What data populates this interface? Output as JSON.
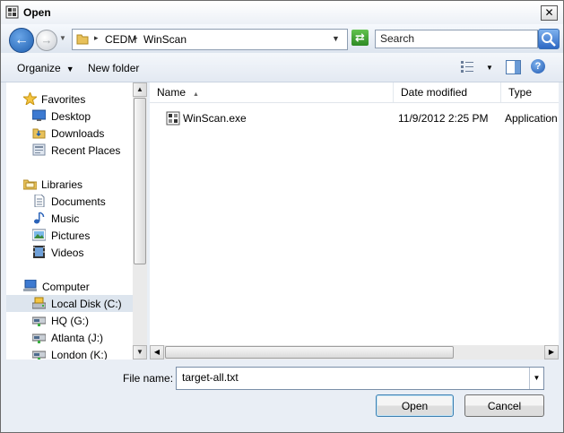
{
  "title": "Open",
  "close_label": "✕",
  "nav": {
    "back_glyph": "←",
    "forward_glyph": "→",
    "breadcrumb": [
      "CEDM",
      "WinScan"
    ],
    "separator": "▸",
    "search_placeholder": "Search"
  },
  "toolbar": {
    "organize_label": "Organize",
    "new_folder_label": "New folder",
    "help_glyph": "?"
  },
  "sidebar": {
    "favorites": {
      "label": "Favorites",
      "icon": "star-icon"
    },
    "favorite_items": [
      {
        "label": "Desktop",
        "icon": "desktop-icon"
      },
      {
        "label": "Downloads",
        "icon": "downloads-icon"
      },
      {
        "label": "Recent Places",
        "icon": "recent-places-icon"
      }
    ],
    "libraries": {
      "label": "Libraries",
      "icon": "libraries-icon"
    },
    "library_items": [
      {
        "label": "Documents",
        "icon": "documents-icon"
      },
      {
        "label": "Music",
        "icon": "music-icon"
      },
      {
        "label": "Pictures",
        "icon": "pictures-icon"
      },
      {
        "label": "Videos",
        "icon": "videos-icon"
      }
    ],
    "computer": {
      "label": "Computer",
      "icon": "computer-icon"
    },
    "computer_items": [
      {
        "label": "Local Disk (C:)",
        "icon": "local-disk-icon",
        "selected": true
      },
      {
        "label": "HQ (G:)",
        "icon": "network-drive-icon"
      },
      {
        "label": "Atlanta (J:)",
        "icon": "network-drive-icon"
      },
      {
        "label": "London (K:)",
        "icon": "network-drive-icon"
      }
    ]
  },
  "file_list": {
    "columns": [
      "Name",
      "Date modified",
      "Type"
    ],
    "rows": [
      {
        "name": "WinScan.exe",
        "date_modified": "11/9/2012 2:25 PM",
        "type": "Application",
        "icon": "application-icon"
      }
    ]
  },
  "bottom": {
    "file_name_label": "File name:",
    "file_name_value": "target-all.txt",
    "open_label": "Open",
    "cancel_label": "Cancel"
  },
  "colors": {
    "window_bg": "#e9eef5",
    "selection": "#dde5ee",
    "accent": "#1f5fb0"
  }
}
